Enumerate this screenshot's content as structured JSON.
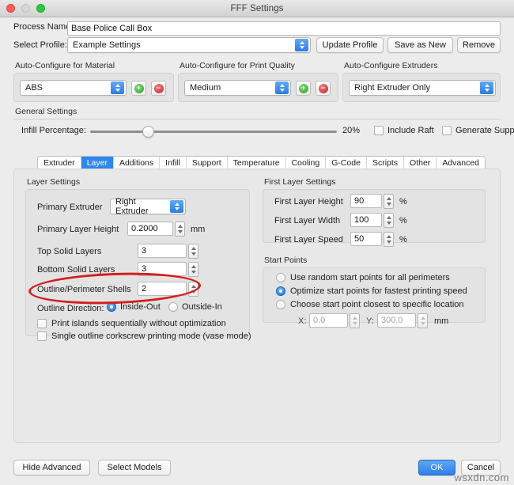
{
  "window": {
    "title": "FFF Settings",
    "traffic_lights": [
      "close-light",
      "minimize-light",
      "zoom-light"
    ]
  },
  "header": {
    "process_name_label": "Process Name:",
    "process_name_value": "Base Police Call Box",
    "select_profile_label": "Select Profile:",
    "select_profile_value": "Example Settings",
    "update_profile_button": "Update Profile",
    "save_as_new_button": "Save as New",
    "remove_button": "Remove"
  },
  "auto_configure": {
    "material": {
      "title": "Auto-Configure for Material",
      "value": "ABS",
      "add_button": "+",
      "remove_button": "−"
    },
    "print_quality": {
      "title": "Auto-Configure for Print Quality",
      "value": "Medium",
      "add_button": "+",
      "remove_button": "−"
    },
    "extruders": {
      "title": "Auto-Configure Extruders",
      "value": "Right Extruder Only"
    }
  },
  "general_settings": {
    "title": "General Settings",
    "infill_label": "Infill Percentage:",
    "infill_value": "20%",
    "infill_percent": 20,
    "include_raft_label": "Include Raft",
    "include_raft_checked": false,
    "generate_support_label": "Generate Support",
    "generate_support_checked": false
  },
  "tabs": [
    {
      "label": "Extruder",
      "active": false
    },
    {
      "label": "Layer",
      "active": true
    },
    {
      "label": "Additions",
      "active": false
    },
    {
      "label": "Infill",
      "active": false
    },
    {
      "label": "Support",
      "active": false
    },
    {
      "label": "Temperature",
      "active": false
    },
    {
      "label": "Cooling",
      "active": false
    },
    {
      "label": "G-Code",
      "active": false
    },
    {
      "label": "Scripts",
      "active": false
    },
    {
      "label": "Other",
      "active": false
    },
    {
      "label": "Advanced",
      "active": false
    }
  ],
  "layer_settings": {
    "title": "Layer Settings",
    "primary_extruder_label": "Primary Extruder",
    "primary_extruder_value": "Right Extruder",
    "primary_layer_height_label": "Primary Layer Height",
    "primary_layer_height_value": "0.2000",
    "primary_layer_height_unit": "mm",
    "top_solid_layers_label": "Top Solid Layers",
    "top_solid_layers_value": "3",
    "bottom_solid_layers_label": "Bottom Solid Layers",
    "bottom_solid_layers_value": "3",
    "outline_shells_label": "Outline/Perimeter Shells",
    "outline_shells_value": "2",
    "outline_direction_label": "Outline Direction:",
    "inside_out_label": "Inside-Out",
    "inside_out_selected": true,
    "outside_in_label": "Outside-In",
    "outside_in_selected": false,
    "print_islands_label": "Print islands sequentially without optimization",
    "print_islands_checked": false,
    "vase_mode_label": "Single outline corkscrew printing mode (vase mode)",
    "vase_mode_checked": false
  },
  "first_layer_settings": {
    "title": "First Layer Settings",
    "height_label": "First Layer Height",
    "height_value": "90",
    "height_unit": "%",
    "width_label": "First Layer Width",
    "width_value": "100",
    "width_unit": "%",
    "speed_label": "First Layer Speed",
    "speed_value": "50",
    "speed_unit": "%"
  },
  "start_points": {
    "title": "Start Points",
    "random_label": "Use random start points for all perimeters",
    "random_selected": false,
    "optimize_label": "Optimize start points for fastest printing speed",
    "optimize_selected": true,
    "specific_label": "Choose start point closest to specific location",
    "specific_selected": false,
    "x_label": "X:",
    "x_value": "0.0",
    "y_label": "Y:",
    "y_value": "300.0",
    "unit": "mm"
  },
  "footer": {
    "hide_advanced_button": "Hide Advanced",
    "select_models_button": "Select Models",
    "ok_button": "OK",
    "cancel_button": "Cancel"
  },
  "watermark": "wsxdn.com",
  "annotation": {
    "shape": "ellipse",
    "color": "#d31f1f",
    "target": "outline-perimeter-shells-row"
  }
}
